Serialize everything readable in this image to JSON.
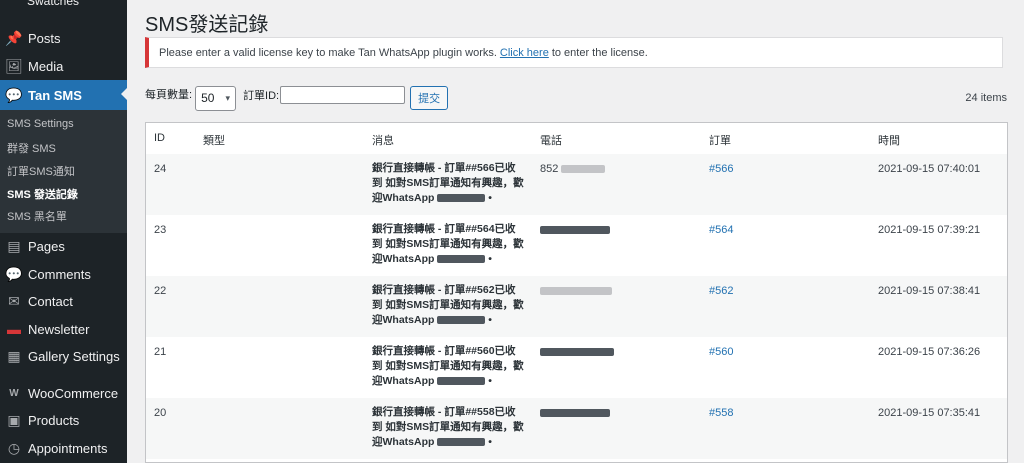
{
  "sidebar": {
    "cut_item": "Swatches",
    "items": [
      {
        "label": "Posts",
        "icon": "pin-icon",
        "glyph": "📌"
      },
      {
        "label": "Media",
        "icon": "media-icon",
        "glyph": "🖼"
      },
      {
        "label": "Tan SMS",
        "icon": "sms-icon",
        "glyph": "💬"
      }
    ],
    "submenu": [
      "SMS Settings",
      "群發 SMS",
      "訂單SMS通知",
      "SMS 發送記錄",
      "SMS 黑名單"
    ],
    "items_after": [
      {
        "label": "Pages",
        "icon": "pages-icon",
        "glyph": "▤"
      },
      {
        "label": "Comments",
        "icon": "comments-icon",
        "glyph": "💬"
      },
      {
        "label": "Contact",
        "icon": "mail-icon",
        "glyph": "✉"
      },
      {
        "label": "Newsletter",
        "icon": "newsletter-icon",
        "glyph": "▬"
      },
      {
        "label": "Gallery Settings",
        "icon": "gallery-icon",
        "glyph": "▦"
      },
      {
        "label": "WooCommerce",
        "icon": "woocommerce-icon",
        "glyph": "W"
      },
      {
        "label": "Products",
        "icon": "products-icon",
        "glyph": "▣"
      },
      {
        "label": "Appointments",
        "icon": "clock-icon",
        "glyph": "◷"
      }
    ]
  },
  "page": {
    "title": "SMS發送記錄",
    "notice_before": "Please enter a valid license key to make Tan WhatsApp plugin works.",
    "notice_link": "Click here",
    "notice_after": "to enter the license."
  },
  "filters": {
    "per_page_label": "每頁數量:",
    "per_page_value": "50",
    "order_id_label": "訂單ID:",
    "order_id_value": "",
    "submit_label": "提交"
  },
  "items_count": "24 items",
  "table": {
    "headers": [
      "ID",
      "類型",
      "消息",
      "電話",
      "訂單",
      "時間"
    ],
    "rows": [
      {
        "id": "24",
        "msg1": "銀行直接轉帳 - 訂單##566已收",
        "msg2": "到 如對SMS訂單通知有興趣，歡",
        "msg3": "迎WhatsApp",
        "phone": "852",
        "order": "#566",
        "time": "2021-09-15 07:40:01"
      },
      {
        "id": "23",
        "msg1": "銀行直接轉帳 - 訂單##564已收",
        "msg2": "到 如對SMS訂單通知有興趣，歡",
        "msg3": "迎WhatsApp",
        "phone": "",
        "order": "#564",
        "time": "2021-09-15 07:39:21"
      },
      {
        "id": "22",
        "msg1": "銀行直接轉帳 - 訂單##562已收",
        "msg2": "到 如對SMS訂單通知有興趣，歡",
        "msg3": "迎WhatsApp",
        "phone": "",
        "order": "#562",
        "time": "2021-09-15 07:38:41"
      },
      {
        "id": "21",
        "msg1": "銀行直接轉帳 - 訂單##560已收",
        "msg2": "到 如對SMS訂單通知有興趣，歡",
        "msg3": "迎WhatsApp",
        "phone": "",
        "order": "#560",
        "time": "2021-09-15 07:36:26"
      },
      {
        "id": "20",
        "msg1": "銀行直接轉帳 - 訂單##558已收",
        "msg2": "到 如對SMS訂單通知有興趣，歡",
        "msg3": "迎WhatsApp",
        "phone": "",
        "order": "#558",
        "time": "2021-09-15 07:35:41"
      }
    ]
  },
  "colors": {
    "accent": "#2271b1",
    "sidebar": "#1d2327",
    "notice_error": "#d63638"
  }
}
